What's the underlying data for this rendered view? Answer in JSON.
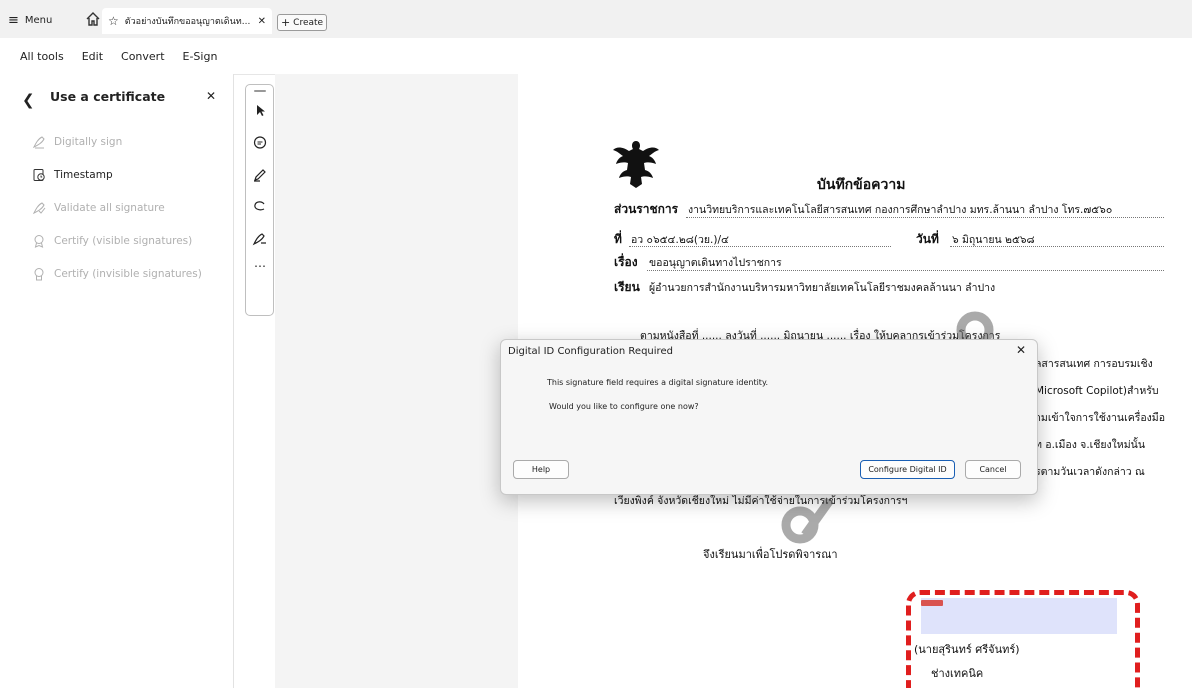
{
  "topbar": {
    "menu_label": "Menu",
    "tab_title": "ตัวอย่างบันทึกขออนุญาตเดินท...",
    "create_label": "Create"
  },
  "menubar": [
    "All tools",
    "Edit",
    "Convert",
    "E-Sign"
  ],
  "panel": {
    "title": "Use a certificate",
    "items": [
      {
        "label": "Digitally sign",
        "enabled": false,
        "icon": "digital-sign-icon"
      },
      {
        "label": "Timestamp",
        "enabled": true,
        "icon": "timestamp-icon"
      },
      {
        "label": "Validate all signature",
        "enabled": false,
        "icon": "validate-signature-icon"
      },
      {
        "label": "Certify (visible signatures)",
        "enabled": false,
        "icon": "certify-visible-icon"
      },
      {
        "label": "Certify (invisible signatures)",
        "enabled": false,
        "icon": "certify-invisible-icon"
      }
    ]
  },
  "tools": [
    "select-arrow-icon",
    "comment-icon",
    "highlight-pen-icon",
    "draw-lasso-icon",
    "sign-pen-icon",
    "more-tools-icon"
  ],
  "document": {
    "heading": "บันทึกข้อความ",
    "dept_label": "ส่วนราชการ",
    "dept_value": "งานวิทยบริการและเทคโนโลยีสารสนเทศ กองการศึกษาลำปาง มทร.ล้านนา ลำปาง โทร.๗๕๖๐",
    "ref_label": "ที่",
    "ref_value": "อว ๐๖๕๔.๒๘(วย.)/๔",
    "date_label": "วันที่",
    "date_value": "๖ มิถุนายน ๒๕๖๘",
    "subject_label": "เรื่อง",
    "subject_value": "ขออนุญาตเดินทางไปราชการ",
    "to_label": "เรียน",
    "to_value": "ผู้อำนวยการสำนักงานบริหารมหาวิทยาลัยเทคโนโลยีราชมงคลล้านนา ลำปาง",
    "body_fragments": [
      "ตามหนังสือที่ ...... ลงวันที่ ...... มิถุนายน ...... เรื่อง ให้บุคลากรเข้าร่วมโครงการ",
      "ลสารสนเทศ การอบรมเชิง",
      "Microsoft Copilot)สำหรับ",
      "ามเข้าใจการใช้งานเครื่องมือ",
      "ท อ.เมือง จ.เชียงใหม่นั้น",
      "รตามวันเวลาดังกล่าว ณ",
      "เวียงพิงค์ จังหวัดเชียงใหม่ ไม่มีค่าใช้จ่ายในการเข้าร่วมโครงการฯ"
    ],
    "closing": "จึงเรียนมาเพื่อโปรดพิจารณา",
    "signer_name": "(นายสุรินทร์   ศรีจันทร์)",
    "signer_position": "ช่างเทคนิค"
  },
  "dialog": {
    "title": "Digital ID Configuration Required",
    "message1": "This signature field requires a digital signature identity.",
    "message2": "Would you like to configure one now?",
    "help_label": "Help",
    "configure_label": "Configure Digital ID",
    "cancel_label": "Cancel"
  },
  "colors": {
    "accent": "#1a5fb4",
    "signature_highlight": "#dfe3fb",
    "dash_red": "#e01e1e"
  }
}
